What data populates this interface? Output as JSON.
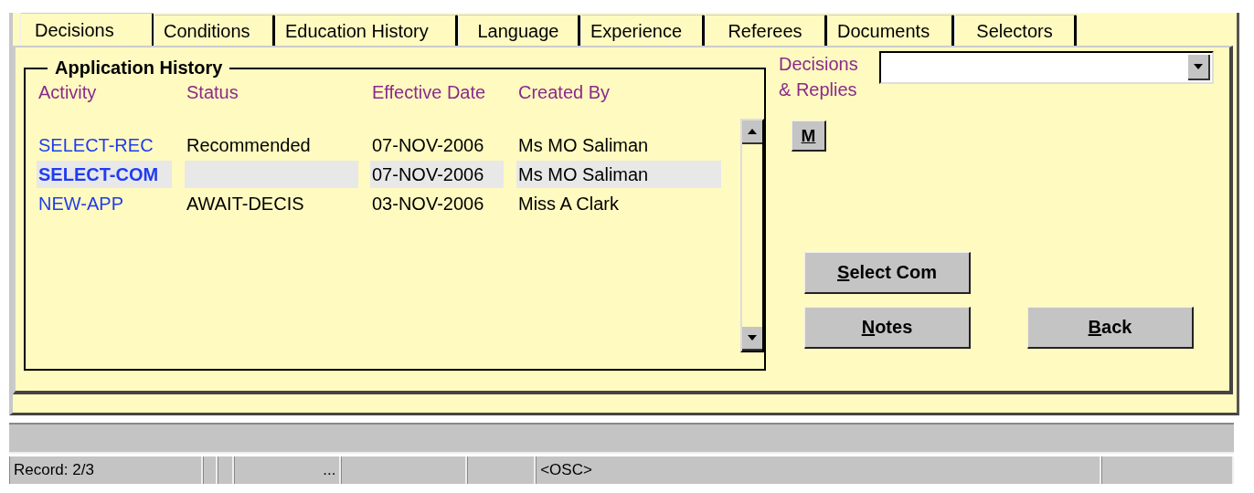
{
  "tabs": [
    {
      "label": "Decisions",
      "selected": true
    },
    {
      "label": "Conditions",
      "selected": false
    },
    {
      "label": "Education History",
      "selected": false
    },
    {
      "label": "Language",
      "selected": false
    },
    {
      "label": "Experience",
      "selected": false
    },
    {
      "label": "Referees",
      "selected": false
    },
    {
      "label": "Documents",
      "selected": false
    },
    {
      "label": "Selectors",
      "selected": false
    }
  ],
  "history": {
    "title": "Application History",
    "columns": [
      "Activity",
      "Status",
      "Effective Date",
      "Created By"
    ],
    "rows": [
      {
        "cells": [
          "SELECT-REC",
          "Recommended",
          "07-NOV-2006",
          "Ms MO Saliman"
        ],
        "selected": false
      },
      {
        "cells": [
          "SELECT-COM",
          null,
          "07-NOV-2006",
          "Ms MO Saliman"
        ],
        "selected": true
      },
      {
        "cells": [
          "NEW-APP",
          "AWAIT-DECIS",
          "03-NOV-2006",
          "Miss A Clark"
        ],
        "selected": false
      }
    ]
  },
  "decisions": {
    "label_lines": [
      "Decisions",
      "& Replies"
    ]
  },
  "m_button": {
    "mnemonic": "M"
  },
  "buttons": [
    {
      "mnemonic": "S",
      "rest": "elect Com"
    },
    {
      "mnemonic": "N",
      "rest": "otes"
    },
    {
      "mnemonic": "B",
      "rest": "ack"
    }
  ],
  "status_bar": {
    "record": "Record: 2/3",
    "field_4": "...",
    "field_7": "<OSC>"
  }
}
